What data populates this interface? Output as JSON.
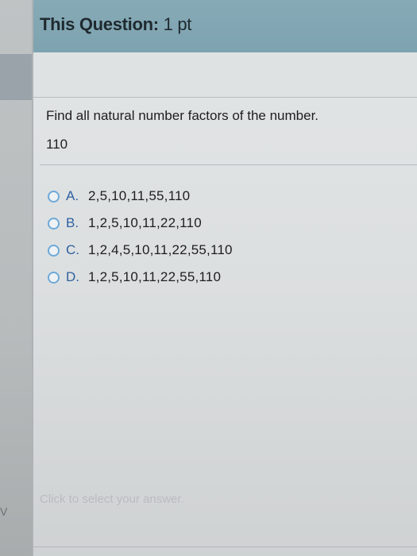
{
  "header": {
    "label": "This Question:",
    "points": "1 pt"
  },
  "question": {
    "prompt": "Find all natural number factors of the number.",
    "number": "110"
  },
  "options": [
    {
      "letter": "A.",
      "value": "2,5,10,11,55,110"
    },
    {
      "letter": "B.",
      "value": "1,2,5,10,11,22,110"
    },
    {
      "letter": "C.",
      "value": "1,2,4,5,10,11,22,55,110"
    },
    {
      "letter": "D.",
      "value": "1,2,5,10,11,22,55,110"
    }
  ],
  "hint": "Click to select your answer.",
  "left_edge_mark": "V",
  "colors": {
    "header_bg": "#7ea3b0",
    "radio_border": "#6ea9d8",
    "option_letter": "#2f5f9f",
    "hint_text": "#b8bcbe"
  }
}
